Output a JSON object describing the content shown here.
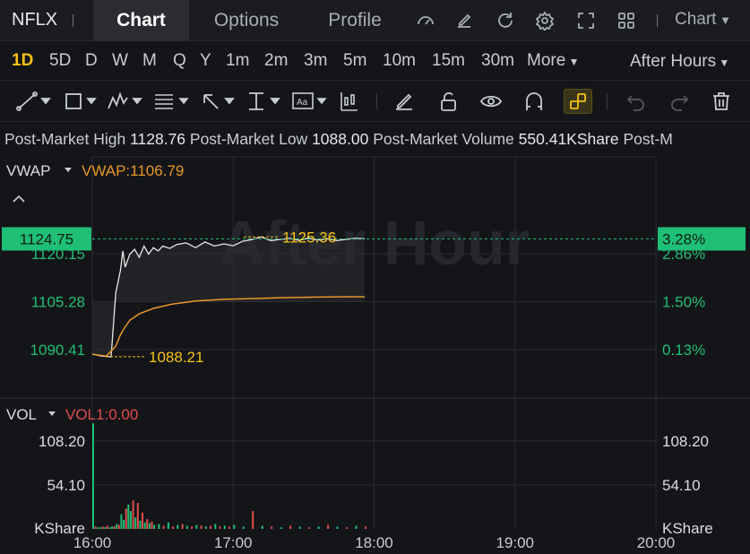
{
  "header": {
    "ticker": "NFLX",
    "tabs": [
      "Chart",
      "Options",
      "Profile"
    ],
    "active_tab": "Chart",
    "chart_menu": "Chart"
  },
  "periods": [
    "1D",
    "5D",
    "D",
    "W",
    "M",
    "Q",
    "Y",
    "1m",
    "2m",
    "3m",
    "5m",
    "10m",
    "15m",
    "30m",
    "More"
  ],
  "active_period": "1D",
  "session": "After Hours",
  "info": {
    "high_label": "Post-Market High",
    "high_value": "1128.76",
    "low_label": "Post-Market Low",
    "low_value": "1088.00",
    "volume_label": "Post-Market Volume",
    "volume_value": "550.41KShare",
    "trailing": "Post-M"
  },
  "watermark": "After Hour",
  "colors": {
    "background": "#141518",
    "price_line": "#e8e8e8",
    "vwap_line": "#e8962a",
    "up": "#1fbf75",
    "down": "#e04d4d",
    "accent": "#f5c216",
    "grid": "#2b2d33"
  },
  "chart_data": [
    {
      "type": "line",
      "panel": "price",
      "indicator_label": "VWAP",
      "indicator_value_label": "VWAP:1106.79",
      "x_range": [
        "16:00",
        "20:00"
      ],
      "x_ticks": [
        "16:00",
        "17:00",
        "18:00",
        "19:00",
        "20:00"
      ],
      "y_ticks_left": [
        "1120.15",
        "1105.28",
        "1090.41"
      ],
      "y_ticks_right": [
        "2.86%",
        "1.50%",
        "0.13%"
      ],
      "y_tick_values": [
        1120.15,
        1105.28,
        1090.41
      ],
      "current_price": "1124.75",
      "current_change": "3.28%",
      "current_price_value": 1124.75,
      "max_label": "1125.36",
      "max_label_value": 1125.36,
      "min_label": "1088.21",
      "min_label_value": 1088.21,
      "series": [
        {
          "name": "Price",
          "x": [
            "16:00",
            "16:04",
            "16:08",
            "16:10",
            "16:12",
            "16:13",
            "16:14",
            "16:16",
            "16:18",
            "16:20",
            "16:22",
            "16:24",
            "16:26",
            "16:28",
            "16:30",
            "16:33",
            "16:36",
            "16:40",
            "16:44",
            "16:48",
            "16:52",
            "16:56",
            "17:00",
            "17:04",
            "17:08",
            "17:12",
            "17:16",
            "17:20",
            "17:24",
            "17:28",
            "17:32",
            "17:36",
            "17:40",
            "17:44",
            "17:48",
            "17:52",
            "17:56"
          ],
          "values": [
            1089.0,
            1088.4,
            1088.2,
            1108,
            1115,
            1121,
            1116,
            1120,
            1121.5,
            1119,
            1122.5,
            1120,
            1122,
            1121,
            1122.5,
            1121.8,
            1123,
            1123.5,
            1122,
            1123.8,
            1122.5,
            1123.2,
            1122.6,
            1124,
            1124.5,
            1125.36,
            1124.2,
            1124.6,
            1124.9,
            1124.3,
            1125,
            1124.4,
            1124.8,
            1124.2,
            1124.6,
            1124.9,
            1124.75
          ]
        },
        {
          "name": "VWAP",
          "x": [
            "16:00",
            "16:06",
            "16:10",
            "16:12",
            "16:14",
            "16:16",
            "16:20",
            "16:26",
            "16:34",
            "16:44",
            "16:56",
            "17:06",
            "17:20",
            "17:36",
            "17:50",
            "17:56"
          ],
          "values": [
            1089.0,
            1088.4,
            1091.5,
            1095,
            1097.5,
            1099.5,
            1101.5,
            1103.2,
            1104.5,
            1105.5,
            1106.0,
            1106.2,
            1106.5,
            1106.7,
            1106.8,
            1106.79
          ]
        }
      ]
    },
    {
      "type": "bar",
      "panel": "volume",
      "indicator_label": "VOL",
      "indicator_value_label": "VOL1:0.00",
      "unit": "KShare",
      "y_ticks": [
        "108.20",
        "54.10"
      ],
      "y_tick_values": [
        108.2,
        54.1
      ],
      "ylim": [
        0,
        130
      ],
      "x": [
        "16:00",
        "16:01",
        "16:02",
        "16:03",
        "16:04",
        "16:05",
        "16:06",
        "16:07",
        "16:08",
        "16:09",
        "16:10",
        "16:11",
        "16:12",
        "16:13",
        "16:14",
        "16:15",
        "16:16",
        "16:17",
        "16:18",
        "16:19",
        "16:20",
        "16:21",
        "16:22",
        "16:23",
        "16:24",
        "16:25",
        "16:26",
        "16:28",
        "16:30",
        "16:32",
        "16:34",
        "16:36",
        "16:38",
        "16:40",
        "16:42",
        "16:44",
        "16:46",
        "16:48",
        "16:50",
        "16:52",
        "16:54",
        "16:56",
        "16:58",
        "17:00",
        "17:04",
        "17:08",
        "17:12",
        "17:16",
        "17:20",
        "17:24",
        "17:28",
        "17:32",
        "17:36",
        "17:40",
        "17:44",
        "17:48",
        "17:52",
        "17:56"
      ],
      "values": [
        130,
        3,
        2,
        2,
        3,
        2,
        4,
        2,
        3,
        3,
        6,
        5,
        18,
        11,
        25,
        30,
        22,
        35,
        14,
        32,
        10,
        20,
        8,
        12,
        7,
        9,
        5,
        6,
        4,
        8,
        3,
        5,
        6,
        4,
        3,
        5,
        4,
        3,
        4,
        6,
        3,
        4,
        3,
        5,
        3,
        22,
        4,
        3,
        2,
        4,
        3,
        2,
        3,
        5,
        3,
        2,
        4,
        3
      ],
      "direction": [
        "up",
        "down",
        "up",
        "up",
        "down",
        "up",
        "down",
        "up",
        "up",
        "down",
        "up",
        "down",
        "up",
        "up",
        "down",
        "up",
        "up",
        "down",
        "up",
        "down",
        "up",
        "down",
        "up",
        "down",
        "up",
        "down",
        "up",
        "up",
        "down",
        "up",
        "down",
        "up",
        "down",
        "up",
        "down",
        "up",
        "down",
        "up",
        "down",
        "up",
        "down",
        "up",
        "down",
        "up",
        "up",
        "down",
        "up",
        "down",
        "up",
        "down",
        "up",
        "down",
        "up",
        "down",
        "up",
        "down",
        "up",
        "down"
      ]
    }
  ]
}
